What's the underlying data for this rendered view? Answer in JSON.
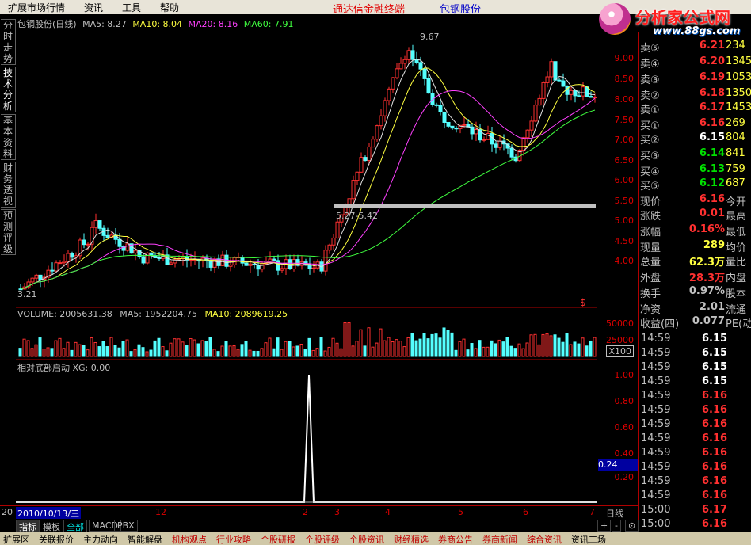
{
  "menu": {
    "items": [
      "扩展市场行情",
      "资讯",
      "工具",
      "帮助"
    ],
    "brand": "通达信金融终端",
    "stock_name": "包钢股份"
  },
  "logo": {
    "title": "分析家公式网",
    "url": "www.88gs.com"
  },
  "left_tabs": [
    "分时走势",
    "技术分析",
    "基本资料",
    "财务透视",
    "预测评级"
  ],
  "kline": {
    "header": {
      "name": "包钢股份(日线)",
      "ma5": "MA5: 8.27",
      "ma10": "MA10: 8.04",
      "ma20": "MA20: 8.16",
      "ma60": "MA60: 7.91"
    },
    "high_label": "9.67",
    "low_label": "3.21",
    "range_label": "5.27-5.42",
    "axis": [
      "9.00",
      "8.50",
      "8.00",
      "7.50",
      "7.00",
      "6.50",
      "6.00",
      "5.50",
      "5.00",
      "4.50",
      "4.00"
    ],
    "marker": "$"
  },
  "volume": {
    "header": {
      "vol": "VOLUME: 2005631.38",
      "ma5": "MA5: 1952204.75",
      "ma10": "MA10: 2089619.25"
    },
    "axis": [
      "50000",
      "25000"
    ],
    "unit": "X100"
  },
  "indicator": {
    "header": "相对底部启动 XG: 0.00",
    "axis": [
      "1.00",
      "0.80",
      "0.60",
      "0.40",
      "0.20"
    ],
    "current": "0.24"
  },
  "xaxis": {
    "date": "2010/10/13/三",
    "labels": [
      "20",
      "12",
      "2",
      "3",
      "4",
      "5",
      "6",
      "7"
    ],
    "period": "日线"
  },
  "bottom_tabs": [
    "指标",
    "模板",
    "全部",
    "MACD",
    "PBX"
  ],
  "bottom_controls": [
    "+",
    "-",
    "⊙"
  ],
  "orderbook": {
    "asks": [
      {
        "label": "卖⑤",
        "price": "6.21",
        "vol": "234"
      },
      {
        "label": "卖④",
        "price": "6.20",
        "vol": "1345"
      },
      {
        "label": "卖③",
        "price": "6.19",
        "vol": "1053"
      },
      {
        "label": "卖②",
        "price": "6.18",
        "vol": "1350"
      },
      {
        "label": "卖①",
        "price": "6.17",
        "vol": "1453"
      }
    ],
    "bids": [
      {
        "label": "买①",
        "price": "6.16",
        "vol": "269",
        "color": "#ff3030"
      },
      {
        "label": "买②",
        "price": "6.15",
        "vol": "804",
        "color": "#ffffff"
      },
      {
        "label": "买③",
        "price": "6.14",
        "vol": "841",
        "color": "#00e000"
      },
      {
        "label": "买④",
        "price": "6.13",
        "vol": "759",
        "color": "#00e000"
      },
      {
        "label": "买⑤",
        "price": "6.12",
        "vol": "687",
        "color": "#00e000"
      }
    ]
  },
  "quote": [
    {
      "label": "现价",
      "value": "6.16",
      "ext": "今开",
      "color": "#ff3030"
    },
    {
      "label": "涨跌",
      "value": "0.01",
      "ext": "最高",
      "color": "#ff3030"
    },
    {
      "label": "涨幅",
      "value": "0.16%",
      "ext": "最低",
      "color": "#ff3030"
    },
    {
      "label": "现量",
      "value": "289",
      "ext": "均价",
      "color": "#ffff40"
    },
    {
      "label": "总量",
      "value": "62.3万",
      "ext": "量比",
      "color": "#ffff40"
    },
    {
      "label": "外盘",
      "value": "28.3万",
      "ext": "内盘",
      "color": "#ff3030"
    }
  ],
  "stats": [
    {
      "label": "换手",
      "value": "0.97%",
      "ext": "股本",
      "color": "#c0c0c0"
    },
    {
      "label": "净资",
      "value": "2.01",
      "ext": "流通",
      "color": "#c0c0c0"
    },
    {
      "label": "收益(四)",
      "value": "0.077",
      "ext": "PE(动",
      "color": "#c0c0c0"
    }
  ],
  "ticks": [
    {
      "time": "14:59",
      "price": "6.15",
      "color": "#ffffff"
    },
    {
      "time": "14:59",
      "price": "6.15",
      "color": "#ffffff"
    },
    {
      "time": "14:59",
      "price": "6.15",
      "color": "#ffffff"
    },
    {
      "time": "14:59",
      "price": "6.15",
      "color": "#ffffff"
    },
    {
      "time": "14:59",
      "price": "6.16",
      "color": "#ff3030"
    },
    {
      "time": "14:59",
      "price": "6.16",
      "color": "#ff3030"
    },
    {
      "time": "14:59",
      "price": "6.16",
      "color": "#ff3030"
    },
    {
      "time": "14:59",
      "price": "6.16",
      "color": "#ff3030"
    },
    {
      "time": "14:59",
      "price": "6.16",
      "color": "#ff3030"
    },
    {
      "time": "14:59",
      "price": "6.16",
      "color": "#ff3030"
    },
    {
      "time": "14:59",
      "price": "6.16",
      "color": "#ff3030"
    },
    {
      "time": "14:59",
      "price": "6.16",
      "color": "#ff3030"
    },
    {
      "time": "15:00",
      "price": "6.17",
      "color": "#ff3030"
    },
    {
      "time": "15:00",
      "price": "6.16",
      "color": "#ff3030"
    }
  ],
  "footer": [
    "扩展区",
    "关联报价",
    "主力动向",
    "智能解盘",
    "机构观点",
    "行业攻略",
    "个股研报",
    "个股评级",
    "个股资讯",
    "财经精选",
    "券商公告",
    "券商新闻",
    "综合资讯",
    "资讯工场"
  ]
}
